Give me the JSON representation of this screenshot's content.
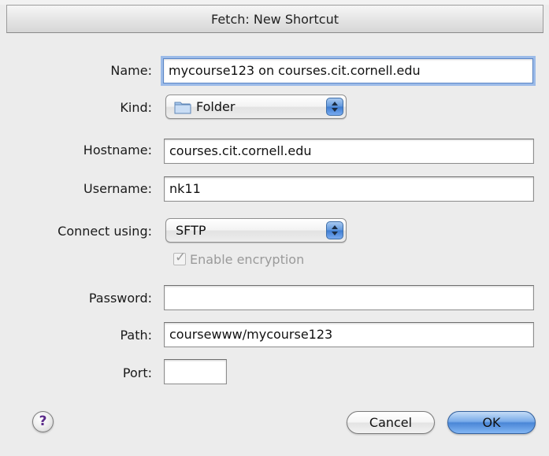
{
  "window": {
    "title": "Fetch: New Shortcut"
  },
  "form": {
    "name_label": "Name:",
    "name_value": "mycourse123 on courses.cit.cornell.edu",
    "kind_label": "Kind:",
    "kind_value": "Folder",
    "hostname_label": "Hostname:",
    "hostname_value": "courses.cit.cornell.edu",
    "username_label": "Username:",
    "username_value": "nk11",
    "connect_label": "Connect using:",
    "connect_value": "SFTP",
    "encryption_label": "Enable encryption",
    "encryption_checked": true,
    "password_label": "Password:",
    "password_value": "",
    "path_label": "Path:",
    "path_value": "coursewww/mycourse123",
    "port_label": "Port:",
    "port_value": ""
  },
  "buttons": {
    "help": "?",
    "cancel": "Cancel",
    "ok": "OK"
  },
  "icons": {
    "kind_icon": "folder-icon",
    "help_icon": "help-icon",
    "popup_arrows": "updown-arrows-icon",
    "checkbox_mark": "checkmark-icon"
  }
}
